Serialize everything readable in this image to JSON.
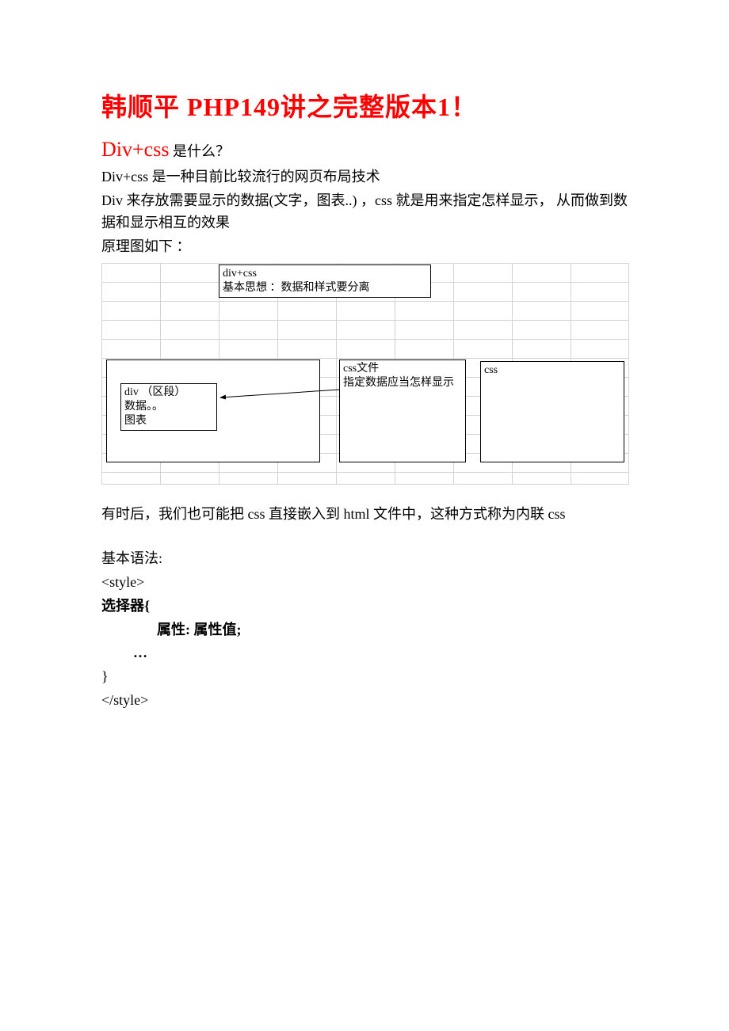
{
  "title": "韩顺平 PHP149讲之完整版本1！",
  "subtitle_red": "Div+css",
  "subtitle_black": " 是什么？",
  "para1": "Div+css 是一种目前比较流行的网页布局技术",
  "para2": "Div 来存放需要显示的数据(文字，图表..) ，css 就是用来指定怎样显示， 从而做到数据和显示相互的效果",
  "para3": "原理图如下 ：",
  "diagram": {
    "top_box_l1": "div+css",
    "top_box_l2": "基本思想 ：数据和样式要分离",
    "left_box_l1": "div （区段）",
    "left_box_l2": "数据。。",
    "left_box_l3": "图表",
    "mid_box_l1": "css文件",
    "mid_box_l2": "指定数据应当怎样显示",
    "right_box": "css"
  },
  "para4": "有时后，我们也可能把 css 直接嵌入到 html 文件中，这种方式称为内联 css",
  "syntax": {
    "l1": "基本语法:",
    "l2": "<style>",
    "l3": "选择器{",
    "l4": "属性: 属性值;",
    "l5": "…",
    "l6": "}",
    "l7": "</style>"
  }
}
